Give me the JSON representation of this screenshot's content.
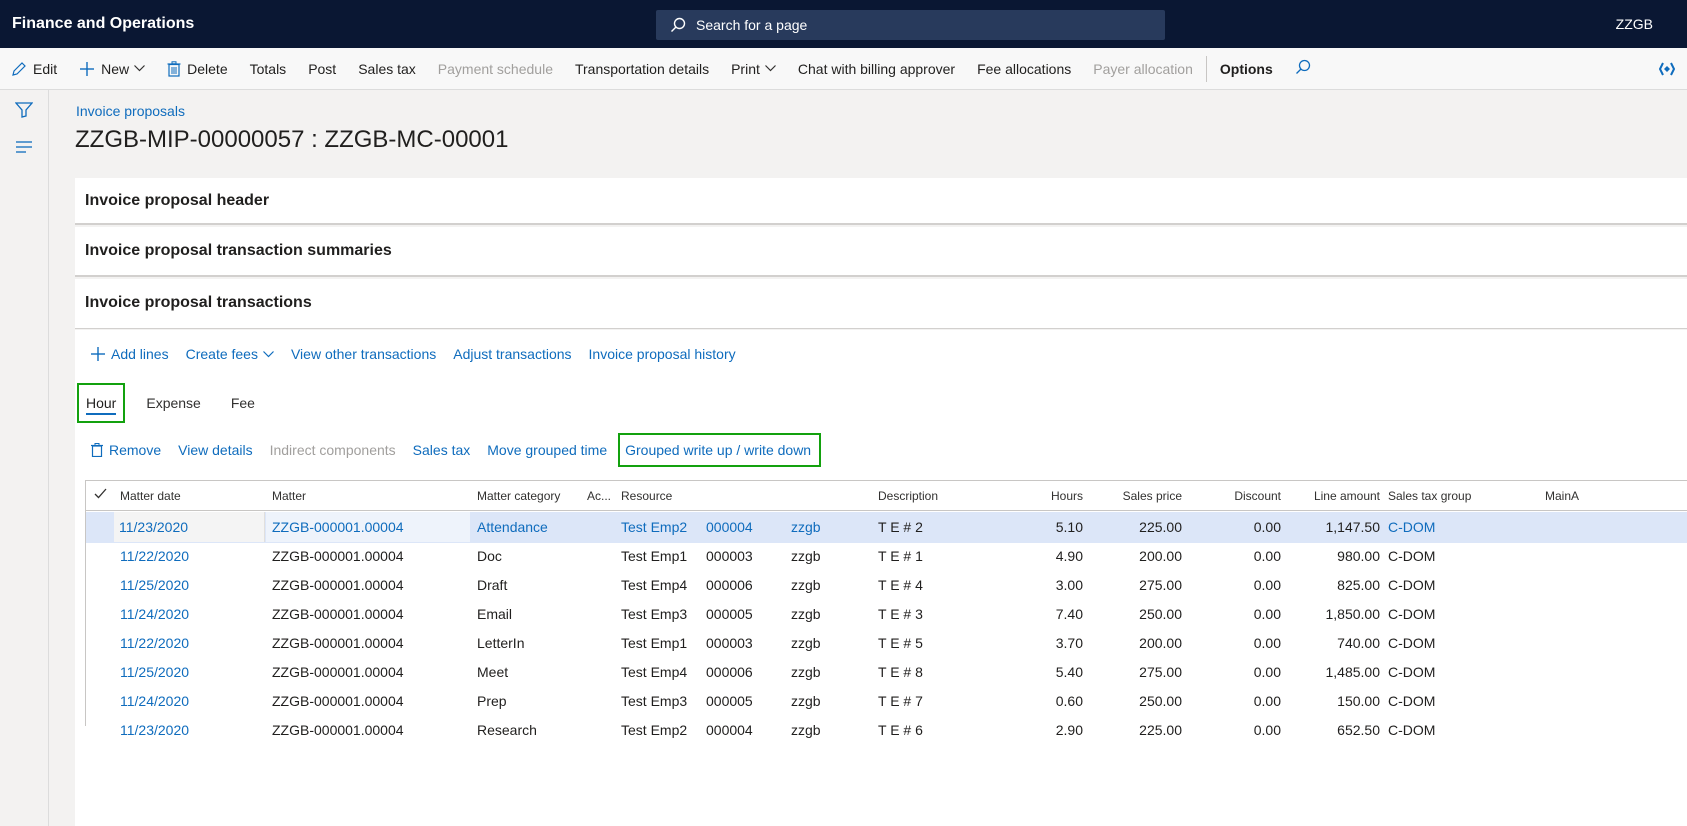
{
  "app": {
    "title": "Finance and Operations",
    "search_placeholder": "Search for a page",
    "company": "ZZGB"
  },
  "actions": {
    "edit": "Edit",
    "new": "New",
    "delete": "Delete",
    "totals": "Totals",
    "post": "Post",
    "sales_tax": "Sales tax",
    "payment_schedule": "Payment schedule",
    "transportation_details": "Transportation details",
    "print": "Print",
    "chat": "Chat with billing approver",
    "fee_allocations": "Fee allocations",
    "payer_allocation": "Payer allocation",
    "options": "Options"
  },
  "page": {
    "breadcrumb": "Invoice proposals",
    "title": "ZZGB-MIP-00000057 : ZZGB-MC-00001"
  },
  "fasttabs": {
    "header": "Invoice proposal header",
    "summaries": "Invoice proposal transaction summaries",
    "transactions": "Invoice proposal transactions"
  },
  "transactions_toolbar": {
    "add_lines": "Add lines",
    "create_fees": "Create fees",
    "view_other": "View other transactions",
    "adjust": "Adjust transactions",
    "history": "Invoice proposal history"
  },
  "tabs": {
    "hour": "Hour",
    "expense": "Expense",
    "fee": "Fee"
  },
  "grid_toolbar": {
    "remove": "Remove",
    "view_details": "View details",
    "indirect": "Indirect components",
    "sales_tax": "Sales tax",
    "move_grouped": "Move grouped time",
    "grouped_write": "Grouped write up / write down"
  },
  "columns": {
    "matter_date": "Matter date",
    "matter": "Matter",
    "matter_category": "Matter category",
    "ac": "Ac...",
    "resource": "Resource",
    "description": "Description",
    "hours": "Hours",
    "sales_price": "Sales price",
    "discount": "Discount",
    "line_amount": "Line amount",
    "sales_tax_group": "Sales tax group",
    "main": "MainA"
  },
  "rows": [
    {
      "date": "11/23/2020",
      "matter": "ZZGB-000001.00004",
      "category": "Attendance",
      "resource": "Test Emp2",
      "res_id": "000004",
      "company": "zzgb",
      "description": "T E # 2",
      "hours": "5.10",
      "price": "225.00",
      "discount": "0.00",
      "amount": "1,147.50",
      "tax": "C-DOM"
    },
    {
      "date": "11/22/2020",
      "matter": "ZZGB-000001.00004",
      "category": "Doc",
      "resource": "Test Emp1",
      "res_id": "000003",
      "company": "zzgb",
      "description": "T E # 1",
      "hours": "4.90",
      "price": "200.00",
      "discount": "0.00",
      "amount": "980.00",
      "tax": "C-DOM"
    },
    {
      "date": "11/25/2020",
      "matter": "ZZGB-000001.00004",
      "category": "Draft",
      "resource": "Test Emp4",
      "res_id": "000006",
      "company": "zzgb",
      "description": "T E # 4",
      "hours": "3.00",
      "price": "275.00",
      "discount": "0.00",
      "amount": "825.00",
      "tax": "C-DOM"
    },
    {
      "date": "11/24/2020",
      "matter": "ZZGB-000001.00004",
      "category": "Email",
      "resource": "Test Emp3",
      "res_id": "000005",
      "company": "zzgb",
      "description": "T E # 3",
      "hours": "7.40",
      "price": "250.00",
      "discount": "0.00",
      "amount": "1,850.00",
      "tax": "C-DOM"
    },
    {
      "date": "11/22/2020",
      "matter": "ZZGB-000001.00004",
      "category": "LetterIn",
      "resource": "Test Emp1",
      "res_id": "000003",
      "company": "zzgb",
      "description": "T E # 5",
      "hours": "3.70",
      "price": "200.00",
      "discount": "0.00",
      "amount": "740.00",
      "tax": "C-DOM"
    },
    {
      "date": "11/25/2020",
      "matter": "ZZGB-000001.00004",
      "category": "Meet",
      "resource": "Test Emp4",
      "res_id": "000006",
      "company": "zzgb",
      "description": "T E # 8",
      "hours": "5.40",
      "price": "275.00",
      "discount": "0.00",
      "amount": "1,485.00",
      "tax": "C-DOM"
    },
    {
      "date": "11/24/2020",
      "matter": "ZZGB-000001.00004",
      "category": "Prep",
      "resource": "Test Emp3",
      "res_id": "000005",
      "company": "zzgb",
      "description": "T E # 7",
      "hours": "0.60",
      "price": "250.00",
      "discount": "0.00",
      "amount": "150.00",
      "tax": "C-DOM"
    },
    {
      "date": "11/23/2020",
      "matter": "ZZGB-000001.00004",
      "category": "Research",
      "resource": "Test Emp2",
      "res_id": "000004",
      "company": "zzgb",
      "description": "T E # 6",
      "hours": "2.90",
      "price": "225.00",
      "discount": "0.00",
      "amount": "652.50",
      "tax": "C-DOM"
    }
  ],
  "icons": {
    "search": "search-icon",
    "edit": "pencil-icon",
    "new": "plus-icon",
    "delete": "trash-icon",
    "filter": "filter-icon",
    "menu": "hamburger-icon",
    "diamond": "diamond-icon",
    "check": "checkmark-icon"
  },
  "colors": {
    "topbar": "#0a1733",
    "link": "#0f6cbd",
    "highlight": "#13a10e",
    "selected_row": "#dce6f8"
  }
}
